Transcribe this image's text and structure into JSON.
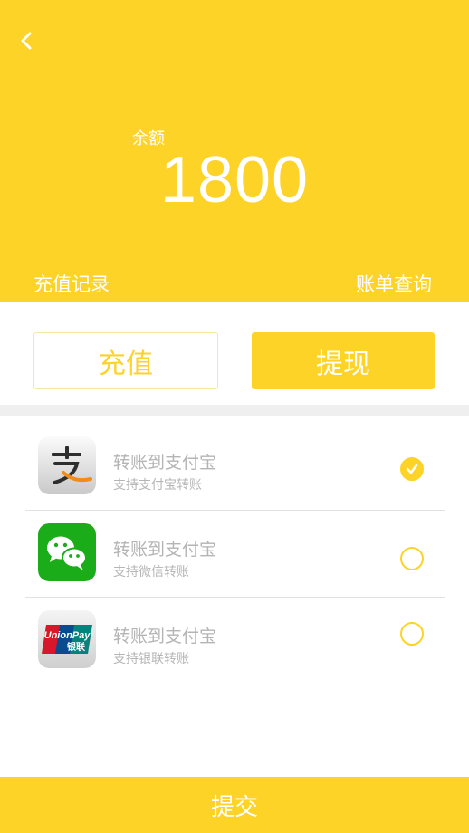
{
  "header": {
    "back_icon": "chevron-left-icon",
    "balance_label": "余额",
    "balance_value": "1800",
    "recharge_record": "充值记录",
    "bill_query": "账单查询",
    "background_color": "#FDD328"
  },
  "actions": {
    "recharge_label": "充值",
    "withdraw_label": "提现"
  },
  "payment_methods": [
    {
      "icon": "alipay-icon",
      "title": "转账到支付宝",
      "subtitle": "支持支付宝转账",
      "selected": true
    },
    {
      "icon": "wechat-icon",
      "title": "转账到支付宝",
      "subtitle": "支持微信转账",
      "selected": false
    },
    {
      "icon": "unionpay-icon",
      "title": "转账到支付宝",
      "subtitle": "支持银联转账",
      "selected": false,
      "icon_text": [
        "UnionPay",
        "银联"
      ]
    }
  ],
  "submit_label": "提交",
  "colors": {
    "accent": "#FDD328",
    "text_muted": "#B5B5B5",
    "divider": "#E2E2E2"
  }
}
